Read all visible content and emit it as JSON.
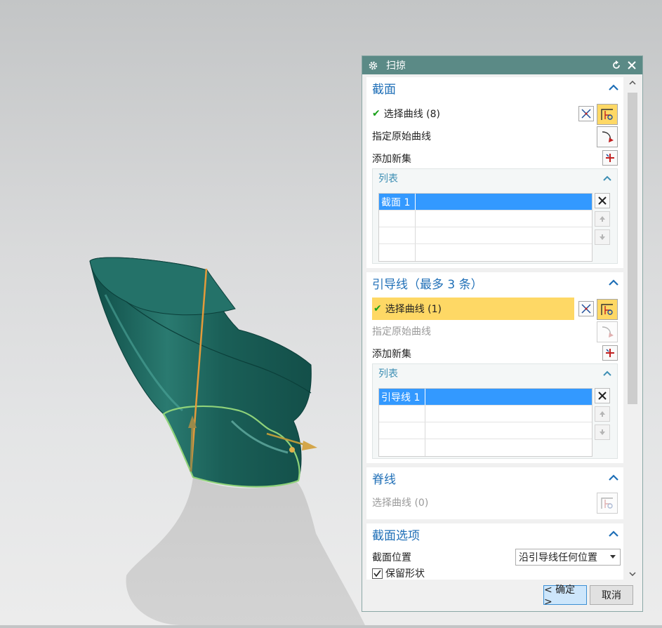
{
  "dialog": {
    "title": "扫掠",
    "reset_tooltip": "",
    "sections": {
      "section": {
        "title": "截面",
        "select_curve": "选择曲线 (8)",
        "specify_origin": "指定原始曲线",
        "add_new_set": "添加新集",
        "list_title": "列表",
        "list_rows": [
          "截面 1",
          "",
          "",
          ""
        ]
      },
      "guide": {
        "title": "引导线（最多 3 条）",
        "select_curve": "选择曲线 (1)",
        "specify_origin": "指定原始曲线",
        "add_new_set": "添加新集",
        "list_title": "列表",
        "list_rows": [
          "引导线 1",
          "",
          "",
          ""
        ]
      },
      "spine": {
        "title": "脊线",
        "select_curve": "选择曲线 (0)"
      },
      "section_options": {
        "title": "截面选项",
        "position_label": "截面位置",
        "position_value": "沿引导线任何位置",
        "keep_shape_label": "保留形状",
        "keep_shape_checked": true
      }
    },
    "ok_label": "< 确定 >",
    "cancel_label": "取消"
  },
  "colors": {
    "title_bar": "#5b8a86",
    "group_title": "#1f6fb7",
    "selected_row": "#3399ff",
    "active_step": "#fed865",
    "model_surface": "#1f6b62",
    "guide_curve": "#e39a3a",
    "section_curve": "#8fd27a"
  },
  "icons": {
    "gear": "gear-icon",
    "reset": "reset-icon",
    "close": "close-icon",
    "collapse": "chevron-up-icon",
    "check": "check-icon",
    "curve_rule": "curve-rule-icon",
    "select_curve": "select-curve-icon",
    "origin_curve": "origin-curve-icon",
    "add_set": "add-set-icon",
    "delete": "delete-icon",
    "move_up": "move-up-icon",
    "move_down": "move-down-icon"
  }
}
